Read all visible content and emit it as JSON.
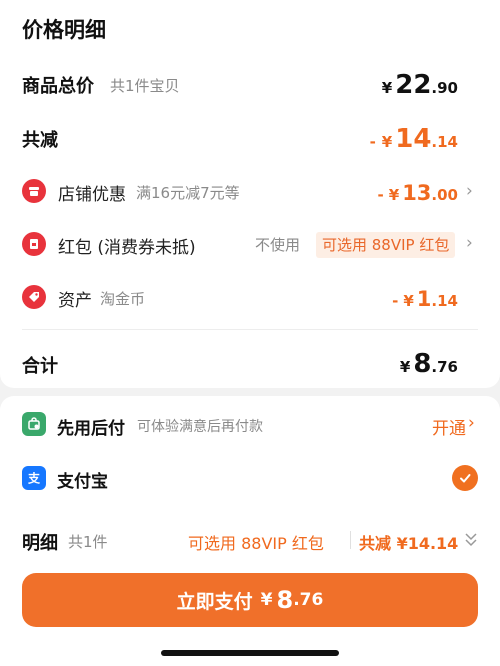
{
  "header": {
    "title": "价格明细"
  },
  "goods_total": {
    "label": "商品总价",
    "sub": "共1件宝贝",
    "currency": "¥",
    "int": "22",
    "dec": ".90"
  },
  "total_reduce": {
    "label": "共减",
    "prefix": "-",
    "currency": "¥",
    "int": "14",
    "dec": ".14"
  },
  "shop_discount": {
    "label": "店铺优惠",
    "sub": "满16元减7元等",
    "prefix": "-",
    "currency": "¥",
    "int": "13",
    "dec": ".00"
  },
  "red_packet": {
    "label": "红包 (消费券未抵)",
    "status": "不使用",
    "badge": "可选用 88VIP 红包"
  },
  "assets": {
    "label": "资产",
    "sub": "淘金币",
    "prefix": "-",
    "currency": "¥",
    "int": "1",
    "dec": ".14"
  },
  "sum": {
    "label": "合计",
    "currency": "¥",
    "int": "8",
    "dec": ".76"
  },
  "pay_later": {
    "label": "先用后付",
    "sub": "可体验满意后再付款",
    "action": "开通"
  },
  "alipay": {
    "label": "支付宝",
    "selected": true
  },
  "detail_bar": {
    "label": "明细",
    "count": "共1件",
    "vip": "可选用 88VIP 红包",
    "reduce": "共减 ¥14.14"
  },
  "pay_button": {
    "label": "立即支付",
    "currency": "¥",
    "int": "8",
    "dec": ".76"
  },
  "colors": {
    "accent": "#f06a1f",
    "button": "#f0702a",
    "icon_red": "#e8333c",
    "pay_later_green": "#3aa86b",
    "alipay_blue": "#1677ff"
  }
}
